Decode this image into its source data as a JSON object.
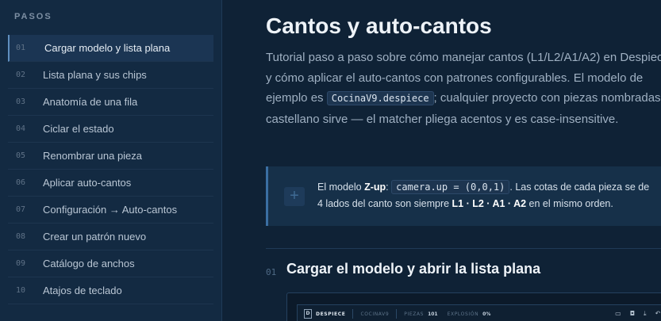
{
  "sidebar": {
    "heading": "PASOS",
    "items": [
      {
        "num": "01",
        "label": "Cargar modelo y lista plana",
        "active": true
      },
      {
        "num": "02",
        "label": "Lista plana y sus chips"
      },
      {
        "num": "03",
        "label": "Anatomía de una fila"
      },
      {
        "num": "04",
        "label": "Ciclar el estado"
      },
      {
        "num": "05",
        "label": "Renombrar una pieza"
      },
      {
        "num": "06",
        "label": "Aplicar auto-cantos"
      },
      {
        "num": "07",
        "label": "Configuración → Auto-cantos"
      },
      {
        "num": "08",
        "label": "Crear un patrón nuevo"
      },
      {
        "num": "09",
        "label": "Catálogo de anchos"
      },
      {
        "num": "10",
        "label": "Atajos de teclado"
      }
    ]
  },
  "main": {
    "title": "Cantos y auto-cantos",
    "intro_before_code": "Tutorial paso a paso sobre cómo manejar cantos (L1/L2/A1/A2) en Despiece y cómo aplicar el auto-cantos con patrones configurables. El modelo de ejemplo es ",
    "intro_code": "CocinaV9.despiece",
    "intro_after_code": "; cualquier proyecto con piezas nombradas en castellano sirve — el matcher pliega acentos y es case-insensitive.",
    "callout": {
      "icon": "plus-icon",
      "t1": "El modelo ",
      "b1": "Z-up",
      "t2": ": ",
      "code": "camera.up = (0,0,1)",
      "t3": ". Las cotas de cada pieza se de",
      "t4": "4 lados del canto son siempre ",
      "b2": "L1 · L2 · A1 · A2",
      "t5": " en el mismo orden."
    },
    "section": {
      "num": "01",
      "title": "Cargar el modelo y abrir la lista plana"
    },
    "preview": {
      "logo": "D",
      "brand": "DESPIECE",
      "model": "COCINAV9",
      "pieces_label": "PIEZAS",
      "pieces_value": "101",
      "explosion_label": "EXPLOSIÓN",
      "explosion_value": "0%"
    }
  }
}
